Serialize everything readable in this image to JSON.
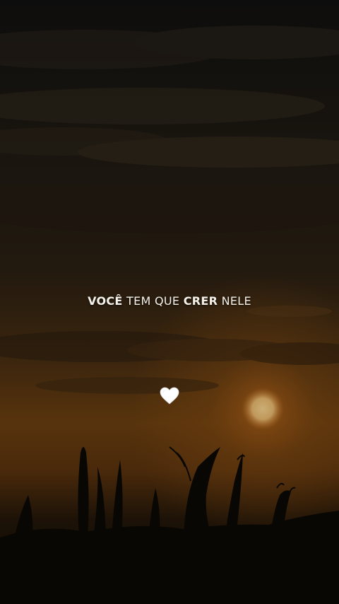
{
  "caption": {
    "part1": "VOCÊ",
    "part2": " TEM QUE ",
    "part3": "CRER",
    "part4": " NELE"
  },
  "icons": {
    "heart": "white-heart-icon"
  },
  "colors": {
    "caption_text": "#f4f1ea",
    "heart": "#ffffff",
    "sun": "#f3c57a",
    "sky_glow": "#8a4e12"
  }
}
